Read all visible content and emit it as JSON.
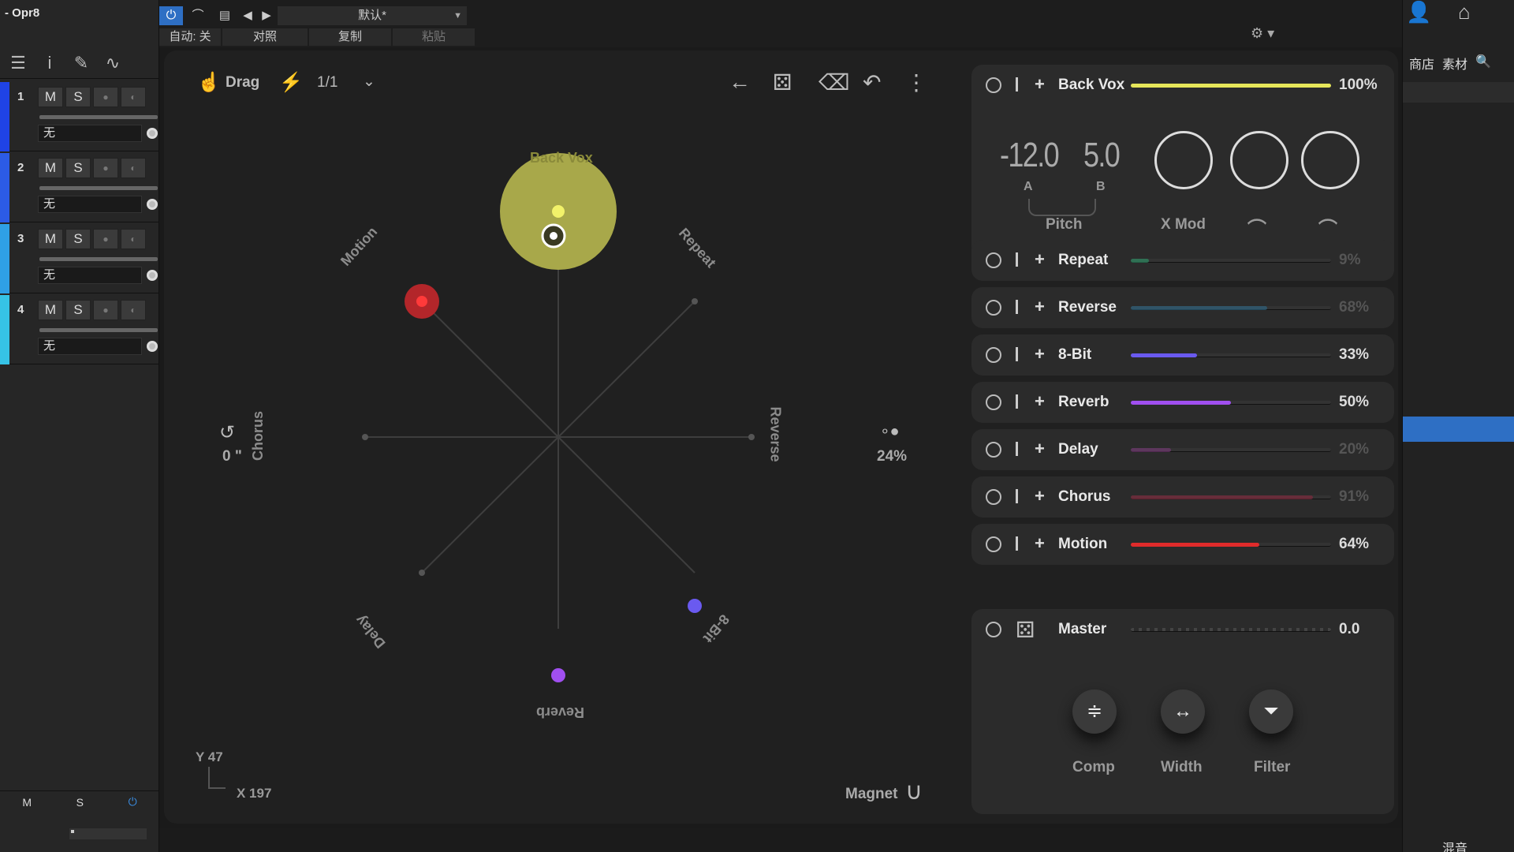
{
  "host": {
    "title": "- Opr8",
    "preset": "默认*",
    "auto_label": "自动: 关",
    "compare_label": "对照",
    "copy_label": "复制",
    "paste_label": "粘贴",
    "right_tabs": [
      "商店",
      "素材"
    ],
    "right_bottom": "混音",
    "left_bottom": {
      "m": "M",
      "s": "S"
    }
  },
  "tracks": [
    {
      "num": "1",
      "m": "M",
      "s": "S",
      "select": "无",
      "color": "#1f43e6"
    },
    {
      "num": "2",
      "m": "M",
      "s": "S",
      "select": "无",
      "color": "#2c5be6"
    },
    {
      "num": "3",
      "m": "M",
      "s": "S",
      "select": "无",
      "color": "#2fa0e6"
    },
    {
      "num": "4",
      "m": "M",
      "s": "S",
      "select": "无",
      "color": "#36c3e6"
    }
  ],
  "plugin": {
    "drag_label": "Drag",
    "ratio": "1/1",
    "rotate_value": "0 \"",
    "spread_value": "24%",
    "magnet_label": "Magnet",
    "coord_y": "Y 47",
    "coord_x": "X 197",
    "radial_labels": {
      "back_vox": "Back Vox",
      "repeat": "Repeat",
      "reverse": "Reverse",
      "bit8": "8-Bit",
      "reverb": "Reverb",
      "delay": "Delay",
      "chorus": "Chorus",
      "motion": "Motion"
    }
  },
  "main_fx": {
    "name": "Back Vox",
    "pct": "100%",
    "level": 1.0,
    "color": "#e6e65a",
    "pitch_a": "-12.0",
    "pitch_b": "5.0",
    "a_label": "A",
    "b_label": "B",
    "pitch_label": "Pitch",
    "xmod_label": "X Mod"
  },
  "fx_rows": [
    {
      "name": "Repeat",
      "pct": "9%",
      "level": 0.09,
      "color": "#2f9a6a",
      "dim": true
    },
    {
      "name": "Reverse",
      "pct": "68%",
      "level": 0.68,
      "color": "#2f6a8a",
      "dim": true
    },
    {
      "name": "8-Bit",
      "pct": "33%",
      "level": 0.33,
      "color": "#6a5af0",
      "dim": false
    },
    {
      "name": "Reverb",
      "pct": "50%",
      "level": 0.5,
      "color": "#a04ff0",
      "dim": false
    },
    {
      "name": "Delay",
      "pct": "20%",
      "level": 0.2,
      "color": "#7a3a7a",
      "dim": true
    },
    {
      "name": "Chorus",
      "pct": "91%",
      "level": 0.91,
      "color": "#8a2a40",
      "dim": true
    },
    {
      "name": "Motion",
      "pct": "64%",
      "level": 0.64,
      "color": "#e02b2b",
      "dim": false
    }
  ],
  "master": {
    "name": "Master",
    "value": "0.0",
    "comp_label": "Comp",
    "width_label": "Width",
    "filter_label": "Filter"
  }
}
